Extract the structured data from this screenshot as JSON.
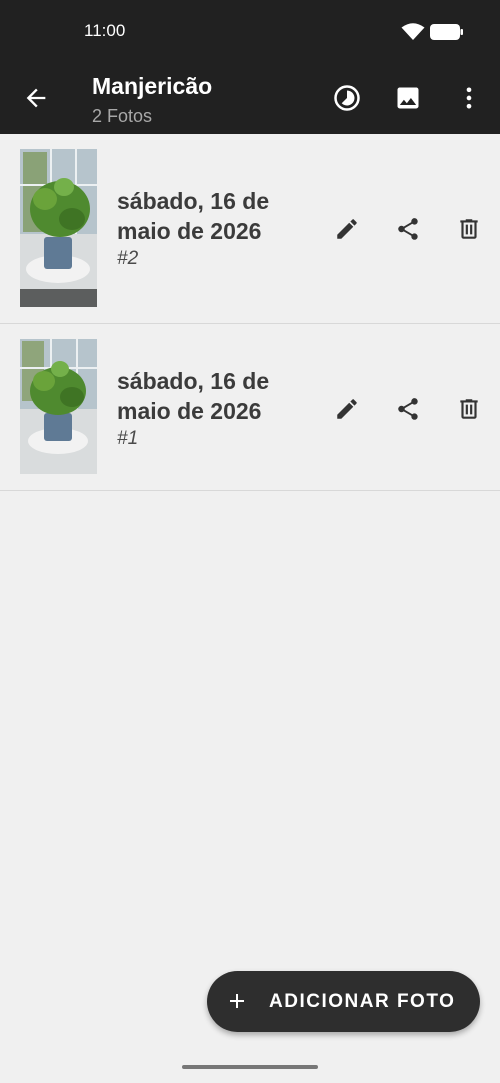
{
  "status_bar": {
    "time": "11:00"
  },
  "app_bar": {
    "title": "Manjericão",
    "subtitle": "2 Fotos",
    "actions": [
      "timelapse-icon",
      "image-icon",
      "more-vert-icon"
    ]
  },
  "photos": [
    {
      "date": "sábado, 16 de maio de 2026",
      "number": "#2"
    },
    {
      "date": "sábado, 16 de maio de 2026",
      "number": "#1"
    }
  ],
  "fab": {
    "label": "ADICIONAR FOTO"
  },
  "colors": {
    "toolbar": "#212121",
    "background": "#f0f0f0",
    "fab": "#2e2e2e"
  }
}
